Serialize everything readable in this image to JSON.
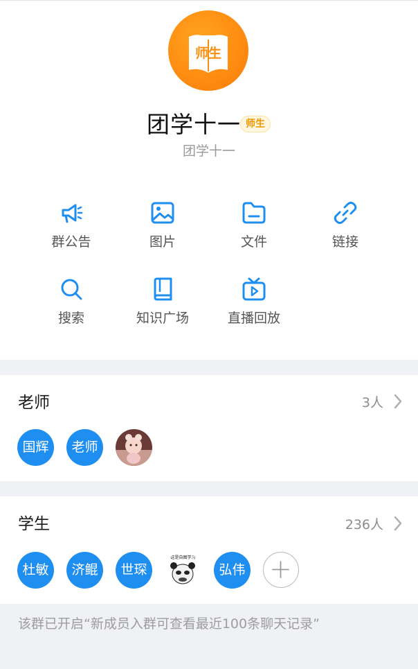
{
  "group": {
    "avatar_text": "师生",
    "name": "团学十一",
    "tag": "师生",
    "subname": "团学十一"
  },
  "functions": [
    {
      "label": "群公告",
      "icon": "megaphone-icon"
    },
    {
      "label": "图片",
      "icon": "image-icon"
    },
    {
      "label": "文件",
      "icon": "folder-icon"
    },
    {
      "label": "链接",
      "icon": "link-icon"
    },
    {
      "label": "搜索",
      "icon": "search-icon"
    },
    {
      "label": "知识广场",
      "icon": "book-icon"
    },
    {
      "label": "直播回放",
      "icon": "tv-play-icon"
    }
  ],
  "teachers": {
    "title": "老师",
    "count": "3人",
    "members": [
      "国辉",
      "老师"
    ]
  },
  "students": {
    "title": "学生",
    "count": "236人",
    "members": [
      "杜敏",
      "济鲲",
      "世琛",
      "弘伟"
    ],
    "sticker_text": "这是自图学习"
  },
  "notice": "该群已开启“新成员入群可查看最近100条聊天记录”",
  "colors": {
    "accent": "#1f8ef1",
    "brand_orange": "#ff8d12",
    "background": "#f0f1f4"
  }
}
